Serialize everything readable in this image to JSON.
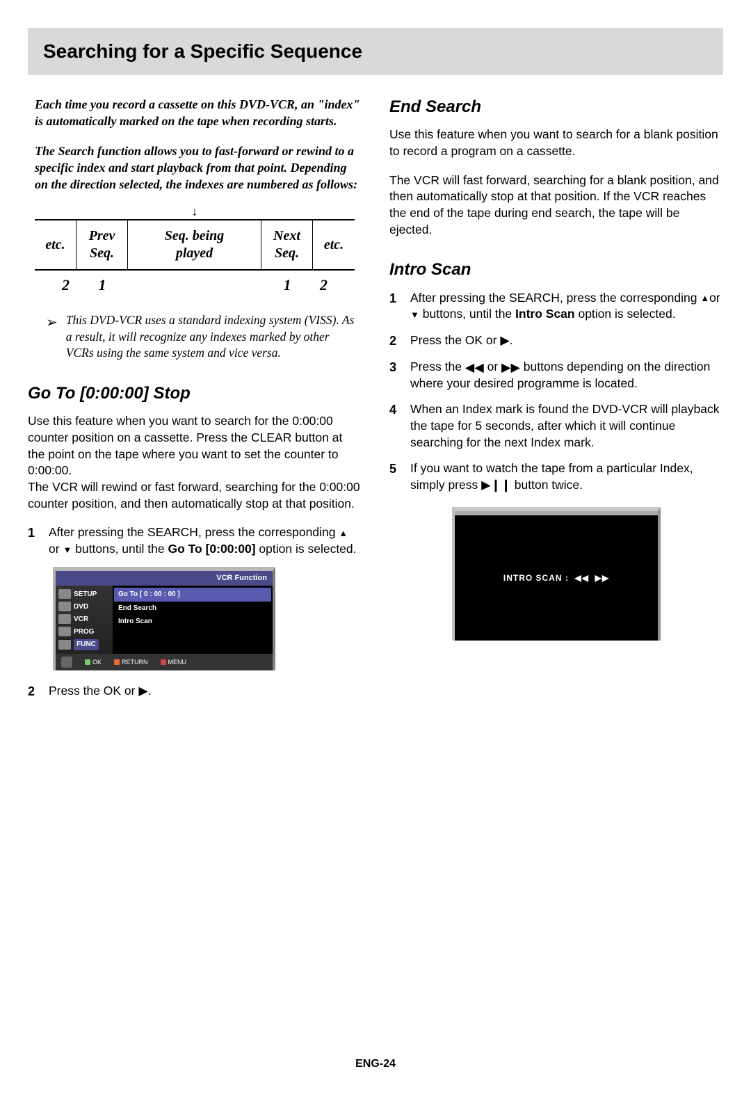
{
  "header": {
    "title": "Searching for a Specific Sequence"
  },
  "intro1": "Each time you record a cassette on this DVD-VCR, an \"index\" is automatically marked on the tape when recording starts.",
  "intro2": "The Search function allows you to fast-forward or rewind to a specific index and start playback from that point. Depending on the direction selected, the indexes are numbered as follows:",
  "seq": {
    "cells": [
      "etc.",
      "Prev\nSeq.",
      "Seq. being\nplayed",
      "Next\nSeq.",
      "etc."
    ],
    "nums": [
      "2",
      "1",
      "1",
      "2"
    ]
  },
  "note": "This DVD-VCR uses a standard indexing system (VISS). As a result, it will recognize any indexes marked by other VCRs using the same system and vice versa.",
  "goto": {
    "title": "Go To [0:00:00] Stop",
    "body": "Use this feature when you want to search for the 0:00:00 counter position on a cassette. Press the CLEAR button at the point on the tape where you want to set the counter to 0:00:00.\nThe VCR will rewind or fast forward, searching for the 0:00:00 counter position, and then automatically stop at that position.",
    "step1_a": "After pressing the SEARCH, press the corresponding ",
    "step1_b": " or ",
    "step1_c": " buttons, until the ",
    "step1_bold": "Go To [0:00:00]",
    "step1_d": " option is selected.",
    "step2": "Press the OK or "
  },
  "osd1": {
    "title": "VCR Function",
    "side": [
      "SETUP",
      "DVD",
      "VCR",
      "PROG",
      "FUNC"
    ],
    "opts": [
      "Go To  [ 0 : 00 : 00 ]",
      "End Search",
      "Intro Scan"
    ],
    "foot": [
      "OK",
      "RETURN",
      "MENU"
    ]
  },
  "end": {
    "title": "End Search",
    "p1": "Use this feature when you want to search for a blank position to record a program on a cassette.",
    "p2": "The VCR will fast forward, searching for a blank position, and then automatically stop at that position. If the VCR reaches the end of the tape during end search, the tape will be ejected."
  },
  "intro_scan": {
    "title": "Intro Scan",
    "s1a": "After pressing the SEARCH, press the corresponding ",
    "s1b": "or ",
    "s1c": " buttons, until the ",
    "s1bold": "Intro Scan",
    "s1d": " option is selected.",
    "s2": "Press the OK or ",
    "s3a": "Press the ",
    "s3b": " or ",
    "s3c": " buttons depending on the direction where your desired programme is located.",
    "s4": "When an Index mark is found the DVD-VCR will playback the tape for 5 seconds, after which it will continue searching for the next Index mark.",
    "s5a": "If you want to watch the tape from a particular Index, simply press ",
    "s5b": " button twice."
  },
  "osd2": {
    "label": "INTRO SCAN   :"
  },
  "footer": "ENG-24"
}
